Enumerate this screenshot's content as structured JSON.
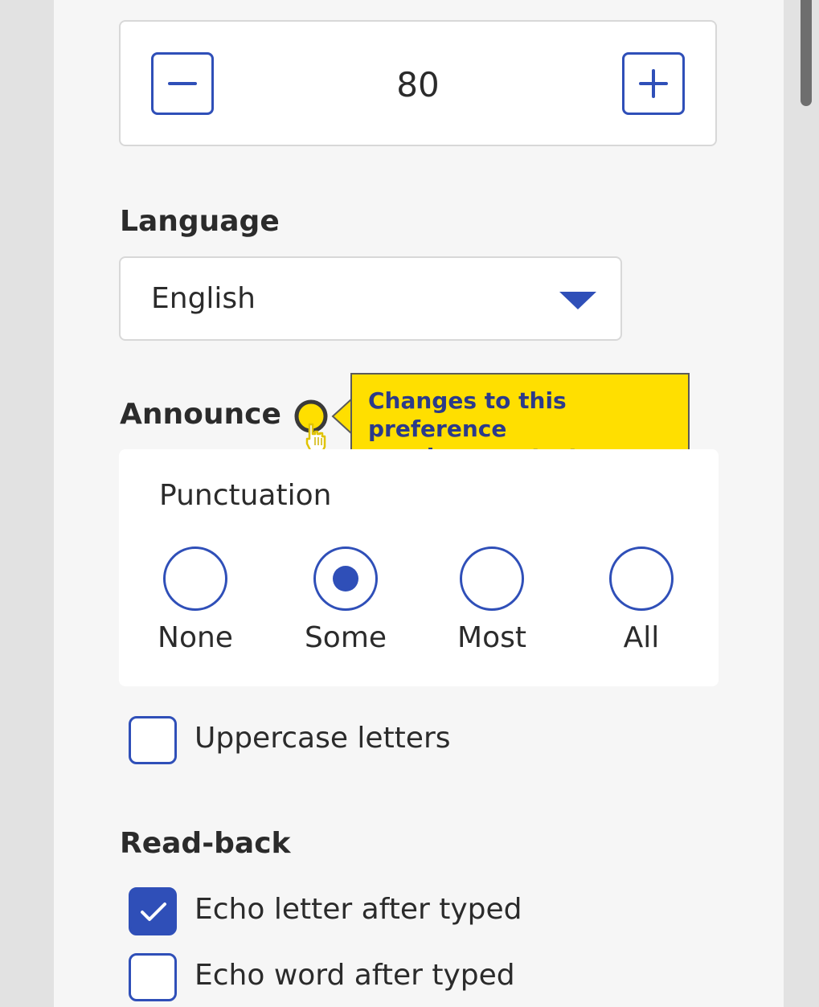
{
  "stepper": {
    "value": "80",
    "decrement_icon": "minus-icon",
    "increment_icon": "plus-icon"
  },
  "language": {
    "heading": "Language",
    "selected": "English",
    "dropdown_icon": "triangle-down-icon"
  },
  "announce": {
    "heading": "Announce",
    "info_icon": "info-circle-icon",
    "tooltip": "Changes to this preference\nrequire a restart",
    "punctuation": {
      "legend": "Punctuation",
      "options": [
        {
          "label": "None",
          "selected": false
        },
        {
          "label": "Some",
          "selected": true
        },
        {
          "label": "Most",
          "selected": false
        },
        {
          "label": "All",
          "selected": false
        }
      ]
    },
    "uppercase": {
      "label": "Uppercase letters",
      "checked": false
    }
  },
  "readback": {
    "heading": "Read-back",
    "echo_letter": {
      "label": "Echo letter after typed",
      "checked": true
    },
    "echo_word": {
      "label": "Echo word after typed",
      "checked": false
    }
  },
  "colors": {
    "accent": "#2f4fb8",
    "tooltip_bg": "#ffdf00",
    "tooltip_text": "#2b3a8a",
    "panel_bg": "#f6f6f6",
    "page_bg": "#e2e2e2"
  }
}
